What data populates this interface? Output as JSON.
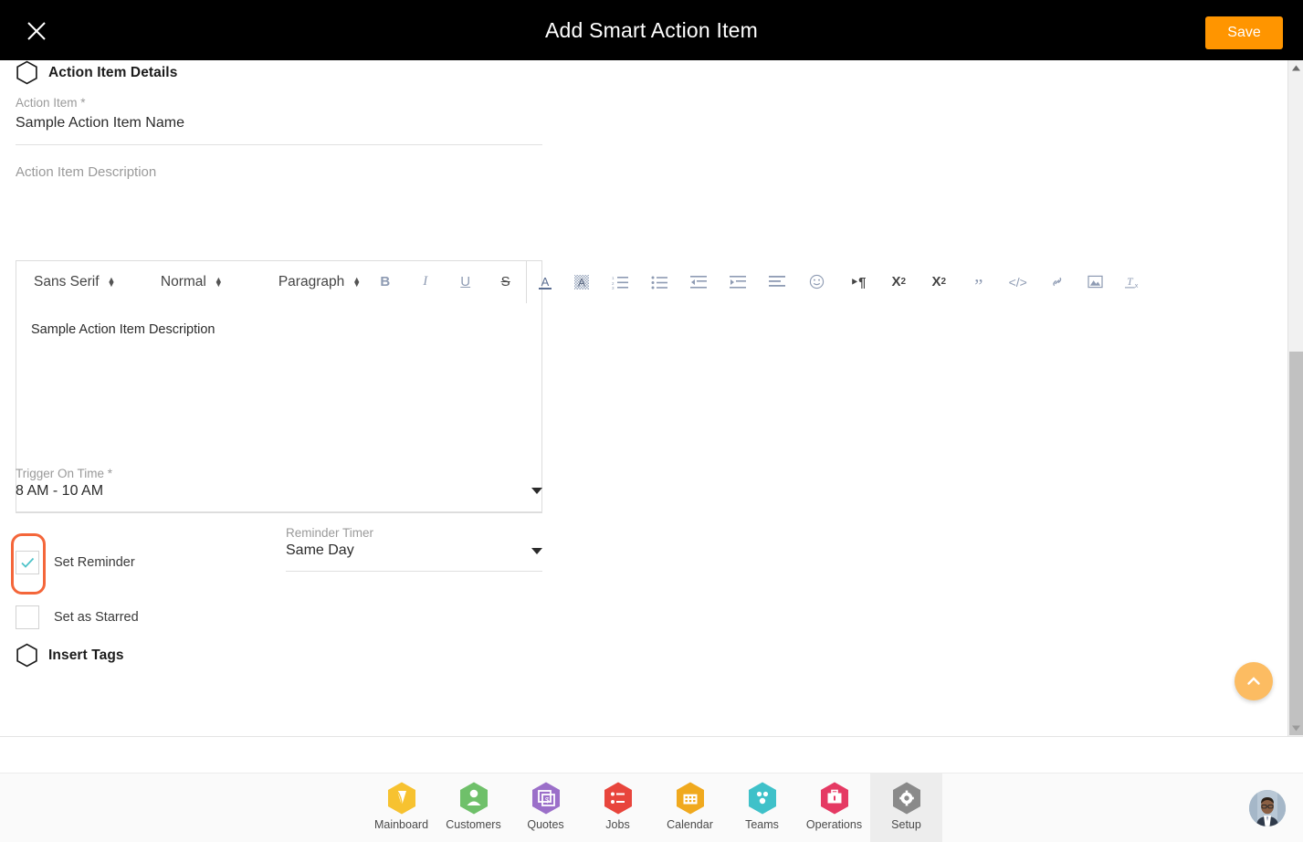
{
  "header": {
    "title": "Add Smart Action Item",
    "close_icon": "close-icon",
    "save_label": "Save",
    "save_color": "#ff9500"
  },
  "form": {
    "section_details_title": "Action Item Details",
    "action_item_label": "Action Item *",
    "action_item_value": "Sample Action Item Name",
    "description_label": "Action Item Description",
    "description_value": "Sample Action Item Description",
    "trigger_label": "Trigger On Time *",
    "trigger_value": "8 AM - 10 AM",
    "set_reminder_label": "Set Reminder",
    "set_reminder_checked": true,
    "reminder_timer_label": "Reminder Timer",
    "reminder_timer_value": "Same Day",
    "set_starred_label": "Set as Starred",
    "set_starred_checked": false,
    "section_tags_title": "Insert Tags",
    "highlight_color": "#f4663a"
  },
  "editor_toolbar": {
    "font_family": "Sans Serif",
    "font_size": "Normal",
    "block_format": "Paragraph",
    "buttons": [
      {
        "name": "bold-icon",
        "glyph": "B"
      },
      {
        "name": "italic-icon",
        "glyph": "I"
      },
      {
        "name": "underline-icon",
        "glyph": "U"
      },
      {
        "name": "strikethrough-icon",
        "glyph": "S"
      },
      {
        "name": "text-color-icon",
        "glyph": "A"
      },
      {
        "name": "background-color-icon",
        "glyph": "A"
      },
      {
        "name": "ordered-list-icon",
        "glyph": "list"
      },
      {
        "name": "bullet-list-icon",
        "glyph": "list"
      },
      {
        "name": "outdent-icon",
        "glyph": "indent"
      },
      {
        "name": "indent-icon",
        "glyph": "indent"
      },
      {
        "name": "align-icon",
        "glyph": "align"
      },
      {
        "name": "emoji-icon",
        "glyph": "emoji"
      },
      {
        "name": "text-direction-icon",
        "glyph": "pilcrow"
      },
      {
        "name": "subscript-icon",
        "glyph": "x2"
      },
      {
        "name": "superscript-icon",
        "glyph": "x2"
      },
      {
        "name": "blockquote-icon",
        "glyph": "quote"
      },
      {
        "name": "code-block-icon",
        "glyph": "code"
      },
      {
        "name": "link-icon",
        "glyph": "link"
      },
      {
        "name": "image-icon",
        "glyph": "image"
      },
      {
        "name": "clear-format-icon",
        "glyph": "Tx"
      }
    ]
  },
  "scroll_fab": {
    "name": "scroll-to-top-button",
    "color": "#fcbc62"
  },
  "bottom_nav": {
    "items": [
      {
        "label": "Mainboard",
        "icon": "mainboard-icon",
        "color": "#f7c230",
        "active": false
      },
      {
        "label": "Customers",
        "icon": "customers-icon",
        "color": "#6fc06a",
        "active": false
      },
      {
        "label": "Quotes",
        "icon": "quotes-icon",
        "color": "#9b6fc9",
        "active": false
      },
      {
        "label": "Jobs",
        "icon": "jobs-icon",
        "color": "#e8453c",
        "active": false
      },
      {
        "label": "Calendar",
        "icon": "calendar-icon",
        "color": "#f0a91e",
        "active": false
      },
      {
        "label": "Teams",
        "icon": "teams-icon",
        "color": "#3fc1c9",
        "active": false
      },
      {
        "label": "Operations",
        "icon": "operations-icon",
        "color": "#e53963",
        "active": false
      },
      {
        "label": "Setup",
        "icon": "setup-gear-icon",
        "color": "#8a8a8a",
        "active": true
      }
    ],
    "avatar": "user-avatar"
  }
}
